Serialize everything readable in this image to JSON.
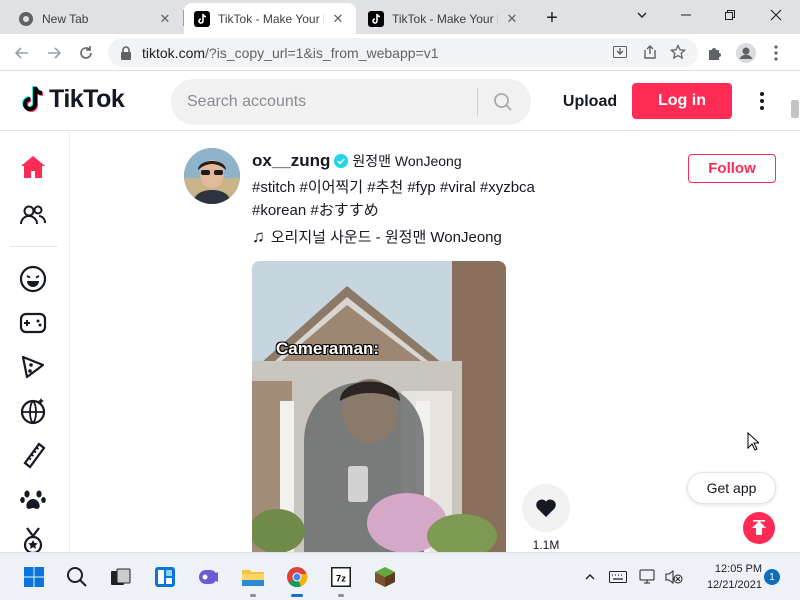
{
  "browser": {
    "tabs": [
      {
        "title": "New Tab",
        "icon": "chrome-icon",
        "active": false
      },
      {
        "title": "TikTok - Make Your Day",
        "icon": "tiktok-icon",
        "active": true
      },
      {
        "title": "TikTok - Make Your Day",
        "icon": "tiktok-icon",
        "active": false
      }
    ],
    "new_tab": "+",
    "url_host": "tiktok.com",
    "url_rest": "/?is_copy_url=1&is_from_webapp=v1"
  },
  "header": {
    "logo_text": "TikTok",
    "search_placeholder": "Search accounts",
    "upload_label": "Upload",
    "login_label": "Log in"
  },
  "sidebar": {
    "icons": [
      "home-icon",
      "following-icon",
      "comedy-icon",
      "gaming-icon",
      "food-icon",
      "dance-icon",
      "beauty-icon",
      "animals-icon",
      "sports-icon"
    ]
  },
  "post": {
    "username": "ox__zung",
    "nickname": "원정맨 WonJeong",
    "caption_line1": "#stitch #이어찍기 #추천 #fyp #viral #xyzbca",
    "caption_line2": "#korean #おすすめ",
    "music": "오리지널 사운드 - 원정맨 WonJeong",
    "follow_label": "Follow",
    "video_overlay_text": "Cameraman:",
    "like_count": "1.1M"
  },
  "floating": {
    "get_app_label": "Get app"
  },
  "taskbar": {
    "time": "12:05 PM",
    "date": "12/21/2021",
    "notification_count": "1"
  },
  "colors": {
    "accent": "#fe2c55",
    "verified": "#20d5ec",
    "tab_strip": "#dfe1e5"
  }
}
